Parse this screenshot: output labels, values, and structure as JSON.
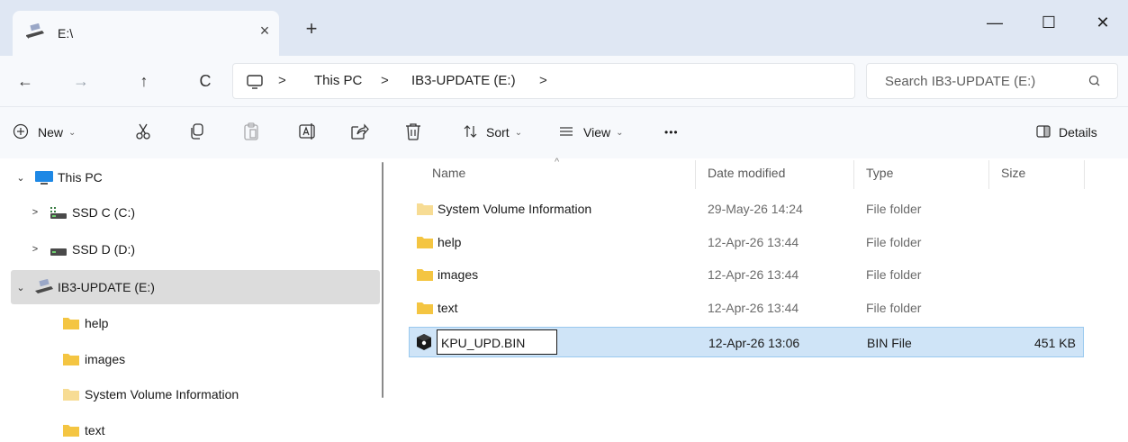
{
  "window": {
    "tab_title": "E:\\",
    "tab_close": "×",
    "new_tab": "+",
    "minimize": "—",
    "maximize": "☐",
    "close": "✕"
  },
  "nav": {
    "back": "←",
    "forward": "→",
    "up": "↑",
    "refresh": "C"
  },
  "address": {
    "crumbs": [
      "This PC",
      "IB3-UPDATE (E:)"
    ],
    "separator": ">"
  },
  "search": {
    "placeholder": "Search IB3-UPDATE (E:)"
  },
  "toolbar": {
    "new_label": "New",
    "sort_label": "Sort",
    "view_label": "View",
    "more_label": "•••",
    "details_label": "Details"
  },
  "tree": {
    "items": [
      {
        "label": "This PC",
        "chevron": "⌄",
        "icon": "monitor-icon"
      },
      {
        "label": "SSD C (C:)",
        "chevron": ">",
        "icon": "drive-icon"
      },
      {
        "label": "SSD D (D:)",
        "chevron": ">",
        "icon": "drive-icon"
      },
      {
        "label": "IB3-UPDATE (E:)",
        "chevron": "⌄",
        "icon": "removable-drive-icon"
      },
      {
        "label": "help",
        "icon": "folder-icon"
      },
      {
        "label": "images",
        "icon": "folder-icon"
      },
      {
        "label": "System Volume Information",
        "icon": "folder-icon"
      },
      {
        "label": "text",
        "icon": "folder-icon"
      }
    ]
  },
  "files": {
    "columns": [
      "Name",
      "Date modified",
      "Type",
      "Size"
    ],
    "rows": [
      {
        "name": "System Volume Information",
        "date": "29-May-26 14:24",
        "type": "File folder",
        "size": ""
      },
      {
        "name": "help",
        "date": "12-Apr-26 13:44",
        "type": "File folder",
        "size": ""
      },
      {
        "name": "images",
        "date": "12-Apr-26 13:44",
        "type": "File folder",
        "size": ""
      },
      {
        "name": "text",
        "date": "12-Apr-26 13:44",
        "type": "File folder",
        "size": ""
      },
      {
        "name": "KPU_UPD.BIN",
        "date": "12-Apr-26 13:06",
        "type": "BIN File",
        "size": "451 KB"
      }
    ]
  },
  "colors": {
    "folder": "#f4c542",
    "selection": "#cfe4f7",
    "tree_selection": "#dcdcdc"
  }
}
